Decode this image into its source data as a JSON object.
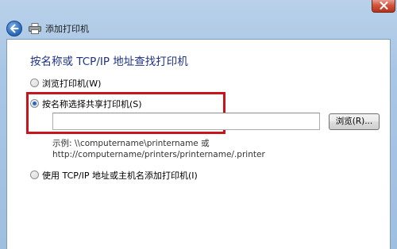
{
  "window": {
    "title": "添加打印机",
    "heading": "按名称或 TCP/IP 地址查找打印机"
  },
  "options": {
    "browse": "浏览打印机(W)",
    "by_name": "按名称选择共享打印机(S)",
    "by_tcpip": "使用 TCP/IP 地址或主机名添加打印机(I)"
  },
  "name_input": {
    "value": ""
  },
  "browse_button": {
    "label": "浏览(R)..."
  },
  "example": {
    "line1": "示例: \\\\computername\\printername 或",
    "line2": "http://computername/printers/printername/.printer"
  },
  "colors": {
    "highlight": "#c8151c",
    "heading": "#1e3287"
  }
}
